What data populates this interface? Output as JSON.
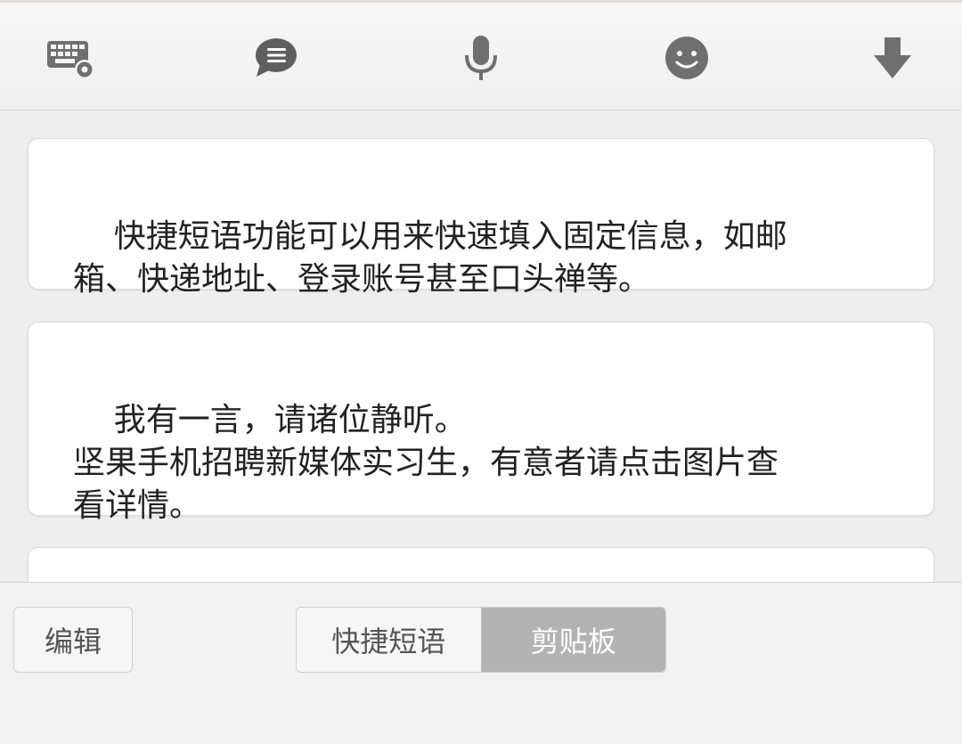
{
  "toolbar": {
    "icons": [
      "keyboard-settings-icon",
      "chat-bubble-icon",
      "microphone-icon",
      "smiley-icon",
      "arrow-down-icon"
    ],
    "icon_color": "#6f6f6f"
  },
  "phrases": [
    {
      "text": "快捷短语功能可以用来快速填入固定信息，如邮\n箱、快递地址、登录账号甚至口头禅等。"
    },
    {
      "text": "我有一言，请诸位静听。\n坚果手机招聘新媒体实习生，有意者请点击图片查\n看详情。"
    },
    {
      "text": ""
    }
  ],
  "bottom": {
    "edit_label": "编辑",
    "tabs": [
      {
        "label": "快捷短语",
        "active": false
      },
      {
        "label": "剪贴板",
        "active": true
      }
    ]
  }
}
